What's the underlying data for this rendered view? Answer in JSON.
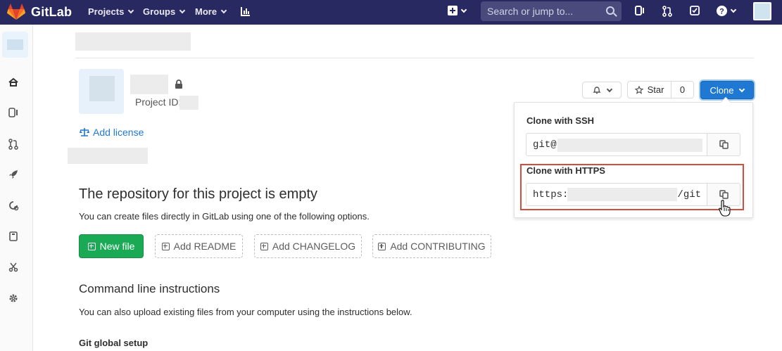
{
  "nav": {
    "brand": "GitLab",
    "projects": "Projects",
    "groups": "Groups",
    "more": "More",
    "search_placeholder": "Search or jump to..."
  },
  "project": {
    "project_id_label": "Project ID:",
    "add_license": "Add license"
  },
  "actions": {
    "star_label": "Star",
    "star_count": "0",
    "clone_label": "Clone"
  },
  "clone_dropdown": {
    "ssh_label": "Clone with SSH",
    "ssh_url": "git@",
    "https_label": "Clone with HTTPS",
    "https_url_prefix": "https:",
    "https_url_suffix": "/git"
  },
  "empty_repo": {
    "title": "The repository for this project is empty",
    "subtitle": "You can create files directly in GitLab using one of the following options.",
    "new_file": "New file",
    "add_readme": "Add README",
    "add_changelog": "Add CHANGELOG",
    "add_contributing": "Add CONTRIBUTING"
  },
  "cli": {
    "title": "Command line instructions",
    "subtitle": "You can also upload existing files from your computer using the instructions below.",
    "git_global_setup": "Git global setup"
  },
  "colors": {
    "nav_bg": "#292961",
    "primary": "#1f78d1",
    "success": "#1aaa55",
    "highlight": "#d04f3a"
  }
}
